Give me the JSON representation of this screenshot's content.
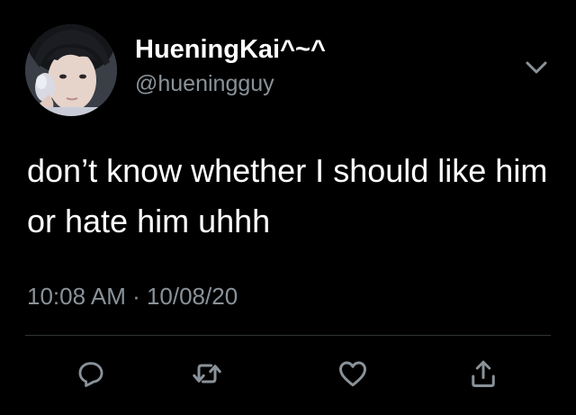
{
  "user": {
    "display_name": "HueningKai^~^",
    "handle": "@hueningguy"
  },
  "tweet": {
    "text": "don’t know whether I should like him or hate him uhhh",
    "timestamp": "10:08 AM · 10/08/20"
  },
  "actions": {
    "reply_icon": "reply-icon",
    "retweet_icon": "retweet-icon",
    "like_icon": "heart-icon",
    "share_icon": "share-icon"
  },
  "colors": {
    "background": "#000000",
    "primary_text": "#ffffff",
    "secondary_text": "#8a9299",
    "divider": "#2f3336",
    "icon": "#8a9299"
  }
}
